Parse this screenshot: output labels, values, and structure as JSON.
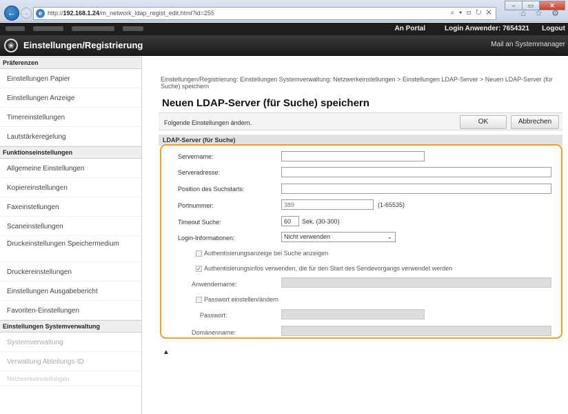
{
  "browser": {
    "url_prefix": "http://",
    "url_host": "192.168.1.24",
    "url_path": "/m_network_ldap_regist_edit.html?id=255",
    "toolbar_glyphs": "⌕ ▾ ⊡ ↻ ✕",
    "right_glyphs": "⌂ ☆ ⚙",
    "window_controls": [
      "–",
      "▭",
      "✕"
    ]
  },
  "header": {
    "portal": "An Portal",
    "login_label": "Login Anwender: 7654321",
    "logout": "Logout",
    "app_title": "Einstellungen/Registrierung",
    "mail_admin": "Mail an Systemmanager"
  },
  "sidebar": {
    "sections": [
      {
        "heading": "Präferenzen",
        "items": [
          "Einstellungen Papier",
          "Einstellungen Anzeige",
          "Timereinstellungen",
          "Lautstärkeregelung"
        ]
      },
      {
        "heading": "Funktionseinstellungen",
        "items": [
          "Allgemeine Einstellungen",
          "Kopiereinstellungen",
          "Faxeinstellungen",
          "Scaneinstellungen",
          "Druckeinstellungen Speichermedium",
          "Druckereinstellungen",
          "Einstellungen Ausgabebericht",
          "Favoriten-Einstellungen"
        ]
      },
      {
        "heading": "Einstellungen Systemverwaltung",
        "items": [
          "Systemverwaltung",
          "Verwaltung Abteilungs-ID",
          "Netzwerkeinstellungen"
        ]
      }
    ]
  },
  "main": {
    "breadcrumb": "Einstellungen/Registrierung: Einstellungen Systemverwaltung: Netzwerkeinstellungen > Einstellungen LDAP-Server > Neuen LDAP-Server (für Suche) speichern",
    "title": "Neuen LDAP-Server (für Suche) speichern",
    "note": "Folgende Einstellungen ändern.",
    "ok": "OK",
    "cancel": "Abbrechen",
    "section": "LDAP-Server (für Suche)",
    "form": {
      "server_name_label": "Servername:",
      "server_name_value": "",
      "server_address_label": "Serveradresse:",
      "server_address_value": "",
      "search_start_label": "Position des Suchstarts:",
      "search_start_value": "",
      "port_label": "Portnummer:",
      "port_value": "389",
      "port_range": "(1-65535)",
      "timeout_label": "Timeout Suche:",
      "timeout_value": "60",
      "timeout_unit": "Sek. (30-300)",
      "login_label": "Login-Informationen:",
      "login_value": "Nicht verwenden",
      "auth_prompt_label": "Authentisierungsanzeige bei Suche anzeigen",
      "auth_prompt_checked": false,
      "auth_reuse_label": "Authentisierungsinfos verwenden, die für den Start des Sendevorgangs verwendet werden",
      "auth_reuse_checked": true,
      "username_label": "Anwendername:",
      "set_password_label": "Passwort einstellen/ändern",
      "set_password_checked": false,
      "password_label": "Passwort:",
      "domain_label": "Domänenname:"
    },
    "scroll_top_glyph": "▲"
  },
  "colors": {
    "highlight": "#f0a020",
    "header_bg": "#1e1e1e",
    "disabled_field": "#dcdcdc"
  }
}
